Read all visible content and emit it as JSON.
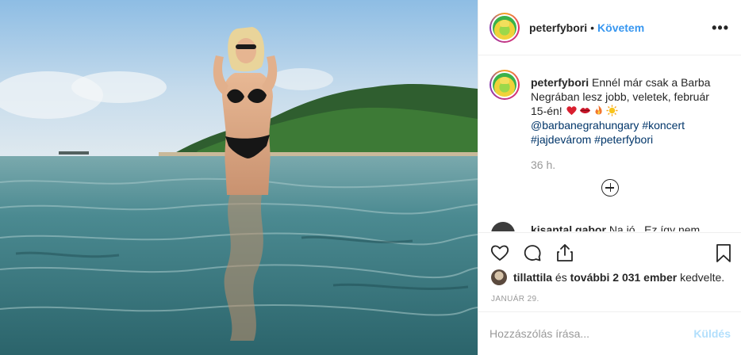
{
  "post": {
    "username": "peterfybori",
    "separator": "•",
    "follow_label": "Követem",
    "more_label": "•••",
    "caption": {
      "username": "peterfybori",
      "line": "Ennél már csak a Barba Negrában lesz jobb, veletek, február 15-én!",
      "emojis": [
        "heart-emoji",
        "lips-emoji",
        "fire-emoji",
        "sun-emoji"
      ],
      "mention": "@barbanegrahungary",
      "tags": [
        "#koncert",
        "#jajdevárom",
        "#peterfybori"
      ],
      "time": "36 h."
    },
    "comment": {
      "username": "kisantal.gabor",
      "text": "Na jó.. Ez így nem"
    },
    "likes": {
      "user": "tillattila",
      "connector": "és",
      "others": "további 2 031 ember",
      "suffix": "kedvelte."
    },
    "date": "JANUÁR 29.",
    "comment_input": {
      "placeholder": "Hozzászólás írása...",
      "value": ""
    },
    "send_label": "Küldés",
    "icons": {
      "like": "heart-outline-icon",
      "comment": "comment-bubble-icon",
      "share": "share-upload-icon",
      "save": "bookmark-icon",
      "load_more": "plus-circle-icon"
    },
    "colors": {
      "accent": "#3897f0",
      "link": "#003569",
      "muted": "#999999",
      "send_disabled": "#b2dffc"
    }
  }
}
